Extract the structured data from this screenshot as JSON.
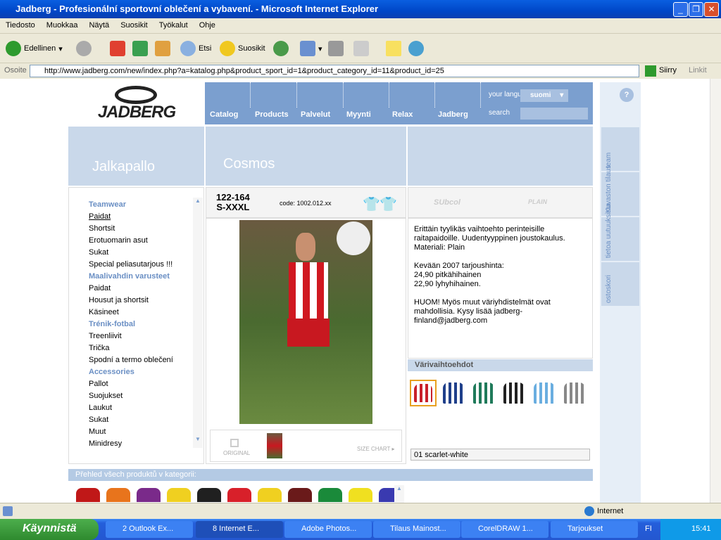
{
  "window": {
    "title": "Jadberg - Profesionální sportovní oblečení a vybavení. - Microsoft Internet Explorer"
  },
  "menu": [
    "Tiedosto",
    "Muokkaa",
    "Näytä",
    "Suosikit",
    "Työkalut",
    "Ohje"
  ],
  "toolbar": {
    "back": "Edellinen",
    "search": "Etsi",
    "favorites": "Suosikit"
  },
  "address": {
    "label": "Osoite",
    "url": "http://www.jadberg.com/new/index.php?a=katalog.php&product_sport_id=1&product_category_id=11&product_id=25",
    "go": "Siirry",
    "links": "Linkit"
  },
  "site": {
    "logo": "JADBERG",
    "nav": [
      "Catalog",
      "Products",
      "Palvelut",
      "Myynti",
      "Relax",
      "Jadberg"
    ],
    "language_label": "your language:",
    "language_value": "suomi",
    "search_label": "search",
    "sport": "Jalkapallo",
    "product_name": "Cosmos",
    "sizes_line1": "122-164",
    "sizes_line2": "S-XXXL",
    "code": "code: 1002.012.xx",
    "fabric_logos": [
      "SUbcol",
      "PLAIN"
    ],
    "categories": [
      {
        "title": "Teamwear",
        "items": [
          "Paidat",
          "Shortsit",
          "Erotuomarin asut",
          "Sukat",
          "Special peliasutarjous !!!"
        ]
      },
      {
        "title": "Maalivahdin varusteet",
        "items": [
          "Paidat",
          "Housut ja shortsit",
          "Käsineet"
        ]
      },
      {
        "title": "Trénik-fotbal",
        "items": [
          "Treenliivit",
          "Trička",
          "Spodní a termo oblečení"
        ]
      },
      {
        "title": "Accessories",
        "items": [
          "Pallot",
          "Suojukset",
          "Laukut",
          "Sukat",
          "Muut",
          "Minidresy"
        ]
      }
    ],
    "description": [
      "Erittäin tyylikäs vaihtoehto perinteisille raitapaidoille. Uudentyyppinen joustokaulus. Materiali: Plain",
      "Kevään 2007 tarjoushinta:",
      "24,90 pitkähihainen",
      "22,90 lyhyhihainen.",
      "HUOM! Myös muut väriyhdistelmät ovat mahdollisia. Kysy lisää jadberg-finland@jadberg.com"
    ],
    "original_label": "ORIGINAL",
    "size_chart": "SIZE CHART ▸",
    "colors_title": "Värivaihtoehdot",
    "color_swatches": [
      "#c8202a",
      "#1f3f8a",
      "#1f7a5a",
      "#222222",
      "#6aaee0",
      "#888888"
    ],
    "selected_color": "01 scarlet-white",
    "overview_title": "Přehled všech produktů v kategorii:",
    "overview_shirts": [
      "#c01818",
      "#e8741c",
      "#7a2a8a",
      "#f0d020",
      "#202020",
      "#d8202a",
      "#f0d020",
      "#6a1a1a",
      "#1a8a3a",
      "#f0e020",
      "#3a3ab0"
    ],
    "side_tabs": [
      "team",
      "Kuvaston tilaus",
      "tietoa uutuuksista",
      "ostoskori"
    ],
    "accent": "#7b9fcf"
  },
  "status": {
    "zone": "Internet"
  },
  "taskbar": {
    "start": "Käynnistä",
    "tasks": [
      "2 Outlook Ex...",
      "8 Internet E...",
      "Adobe Photos...",
      "Tilaus Mainost...",
      "CorelDRAW 1...",
      "Tarjoukset"
    ],
    "lang": "FI",
    "clock": "15:41"
  }
}
